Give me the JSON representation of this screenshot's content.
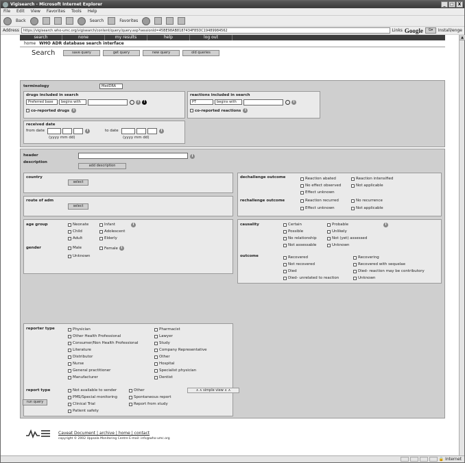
{
  "window": {
    "title": "Vigisearch - Microsoft Internet Explorer",
    "min": "_",
    "max": "□",
    "close": "X"
  },
  "menu": [
    "File",
    "Edit",
    "View",
    "Favorites",
    "Tools",
    "Help"
  ],
  "toolbar": {
    "back": "Back",
    "search": "Search",
    "favorites": "Favorites"
  },
  "address": {
    "label": "Address",
    "url": "https://vigisearch.who-umc.org/vigisearch/content/query/query.asp?sessionId=45BE98AB8187434F85DC19489984562",
    "links": "Links",
    "google": "Google",
    "g_box": "G▾",
    "installs": "Install/enge"
  },
  "nav": {
    "items": [
      "search",
      "none",
      "my results",
      "help",
      "log out"
    ],
    "home": "home",
    "app_title": "WHO ADR database search interface"
  },
  "search": {
    "heading": "Search",
    "buttons": [
      "save query",
      "get query",
      "new query",
      "old queries"
    ]
  },
  "terminology": {
    "label": "terminology",
    "value": "MedDRA"
  },
  "drugs": {
    "label": "drugs included in search",
    "type": "Preferred base",
    "match": "begins with",
    "coreported": "co-reported drugs"
  },
  "reactions": {
    "label": "reactions included in search",
    "type": "PT",
    "match": "begins with",
    "coreported": "co-reported reactions"
  },
  "dates": {
    "label": "received date",
    "from": "from date",
    "to": "to date",
    "fmt1": "(yyyy mm dd)",
    "fmt2": "(yyyy mm dd)"
  },
  "header": {
    "label": "header",
    "desc_label": "description",
    "add_desc": "add description"
  },
  "country": {
    "label": "country",
    "select": "select"
  },
  "route": {
    "label": "route of adm",
    "select": "select"
  },
  "dechallenge": {
    "label": "dechallenge outcome",
    "opts": [
      "Reaction abated",
      "Reaction intensified",
      "No effect observed",
      "Not applicable",
      "Effect unknown"
    ]
  },
  "rechallenge": {
    "label": "rechallenge outcome",
    "opts": [
      "Reaction recurred",
      "No recurrence",
      "Effect unknown",
      "Not applicable"
    ]
  },
  "age": {
    "label": "age group",
    "opts": [
      "Neonate",
      "Infant",
      "Child",
      "Adolescent",
      "Adult",
      "Elderly"
    ]
  },
  "gender": {
    "label": "gender",
    "opts": [
      "Male",
      "Female",
      "Unknown"
    ]
  },
  "causality": {
    "label": "causality",
    "opts": [
      "Certain",
      "Probable",
      "Possible",
      "Unlikely",
      "No relationship",
      "Not (yet) assessed",
      "Not assessable",
      "Unknown"
    ]
  },
  "outcome": {
    "label": "outcome",
    "opts": [
      "Recovered",
      "Recovering",
      "Not recovered",
      "Recovered with sequelae",
      "Died",
      "Died- reaction may be contributory",
      "Died- unrelated to reaction",
      "Unknown"
    ]
  },
  "reporter": {
    "label": "reporter type",
    "left": [
      "Physician",
      "Other Health Professional",
      "Consumer/Non Health Professional",
      "Literature",
      "Distributor",
      "Nurse",
      "General practitioner",
      "Manufacturer"
    ],
    "right": [
      "Pharmacist",
      "Lawyer",
      "Study",
      "Company Representative",
      "Other",
      "Hospital",
      "Specialist physician",
      "Dentist"
    ]
  },
  "report": {
    "label": "report type",
    "opts": [
      "Not available to sender",
      "Other",
      "PMS/Special monitoring",
      "Spontaneous report",
      "Clinical Trial",
      "Report from study",
      "Patient safety"
    ]
  },
  "toggle": "∧ ∧ simple view ∧ ∧",
  "run": "run query",
  "footer": {
    "links": "Caveat Document | archive | home | contact",
    "copy": "copyright © 2002 Uppsala Monitoring Centre  E-mail: info@who-umc.org",
    "status_zone": "Internet"
  }
}
